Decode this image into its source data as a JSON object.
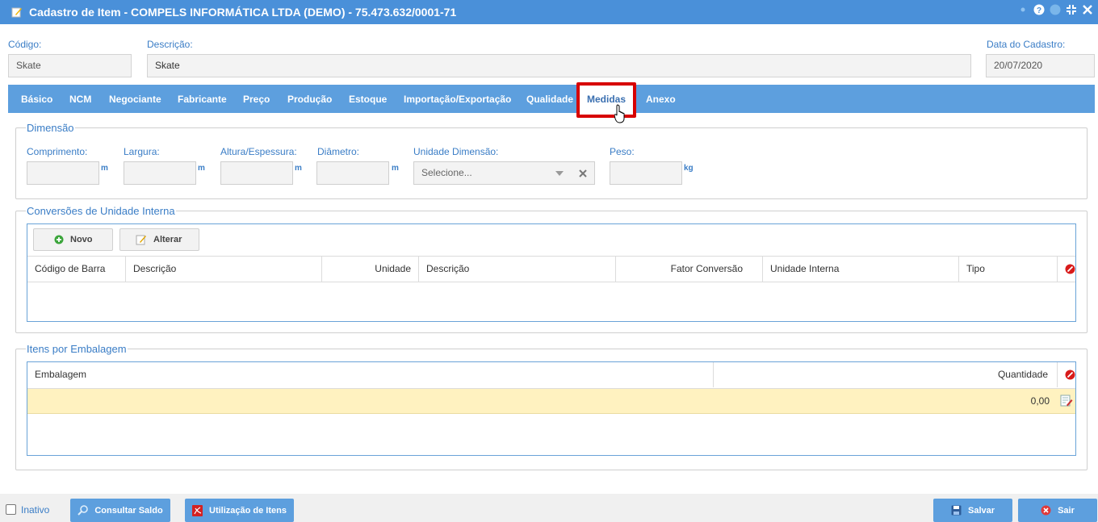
{
  "window": {
    "title": "Cadastro de Item - COMPELS INFORMÁTICA LTDA (DEMO) - 75.473.632/0001-71"
  },
  "header": {
    "codigo_label": "Código:",
    "codigo_value": "Skate",
    "descricao_label": "Descrição:",
    "descricao_value": "Skate",
    "data_label": "Data do Cadastro:",
    "data_value": "20/07/2020"
  },
  "tabs": [
    {
      "label": "Básico"
    },
    {
      "label": "NCM"
    },
    {
      "label": "Negociante"
    },
    {
      "label": "Fabricante"
    },
    {
      "label": "Preço"
    },
    {
      "label": "Produção"
    },
    {
      "label": "Estoque"
    },
    {
      "label": "Importação/Exportação"
    },
    {
      "label": "Qualidade"
    },
    {
      "label": "Medidas"
    },
    {
      "label": "Anexo"
    }
  ],
  "dimensao": {
    "legend": "Dimensão",
    "comprimento_label": "Comprimento:",
    "largura_label": "Largura:",
    "altura_label": "Altura/Espessura:",
    "diametro_label": "Diâmetro:",
    "unidade_label": "Unidade Dimensão:",
    "peso_label": "Peso:",
    "unit_m": "m",
    "unit_kg": "kg",
    "unidade_placeholder": "Selecione..."
  },
  "conversoes": {
    "legend": "Conversões de Unidade Interna",
    "novo_label": "Novo",
    "alterar_label": "Alterar",
    "columns": [
      "Código de Barra",
      "Descrição",
      "Unidade",
      "Descrição",
      "Fator Conversão",
      "Unidade Interna",
      "Tipo"
    ]
  },
  "embalagem": {
    "legend": "Itens por Embalagem",
    "columns": [
      "Embalagem",
      "Quantidade"
    ],
    "row_quantidade": "0,00"
  },
  "footer": {
    "inativo_label": "Inativo",
    "consultar_label": "Consultar Saldo",
    "utilizacao_label": "Utilização de Itens",
    "salvar_label": "Salvar",
    "sair_label": "Sair"
  },
  "colors": {
    "accent": "#5d9fde",
    "titlebar": "#4a90d9",
    "highlight": "#d70000",
    "row_highlight": "#fff2c0"
  }
}
